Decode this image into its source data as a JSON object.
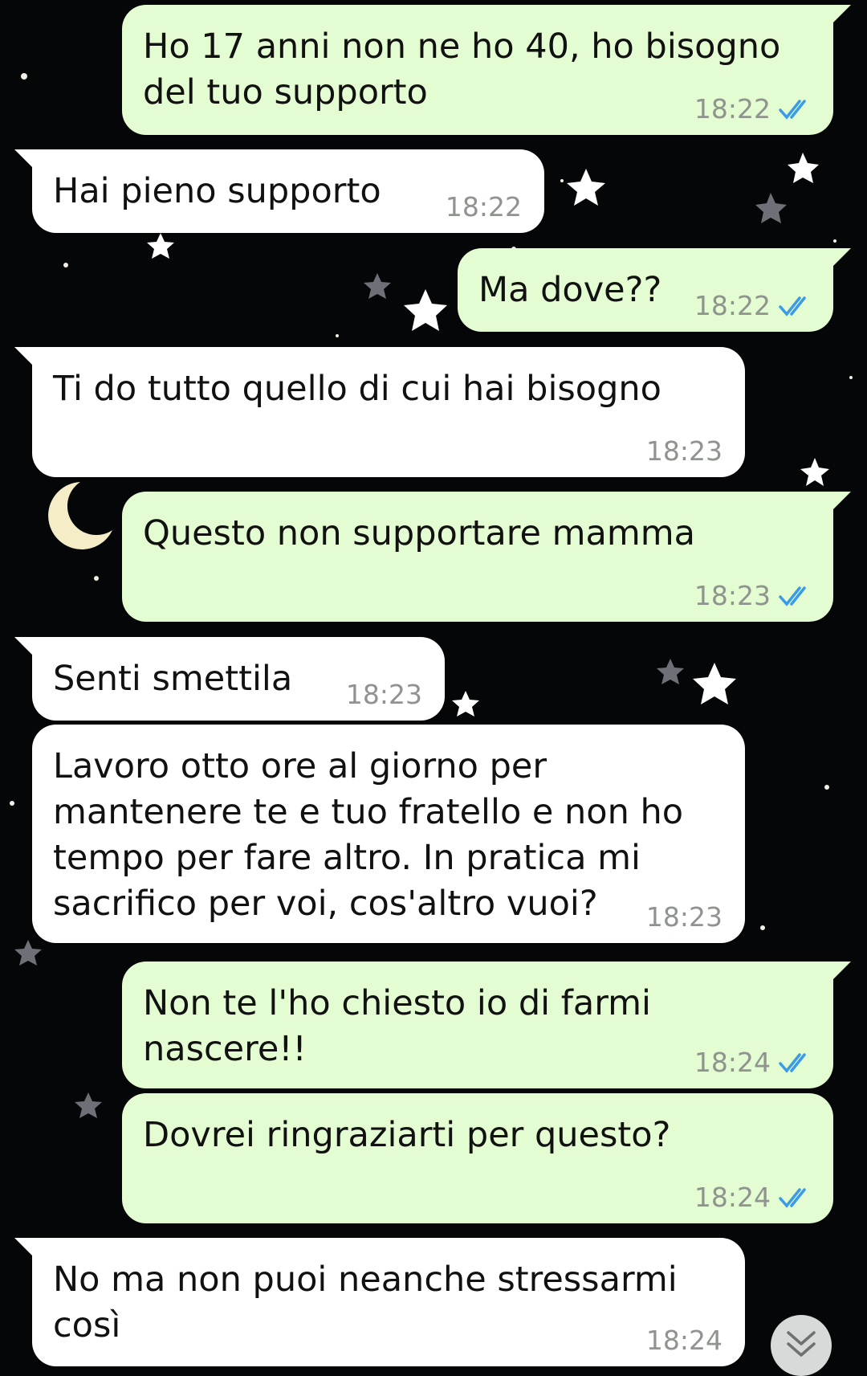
{
  "chat": {
    "messages": [
      {
        "dir": "out",
        "text": "Ho 17 anni non ne ho 40, ho bisogno\ndel tuo supporto",
        "time": "18:22",
        "read": true
      },
      {
        "dir": "in",
        "text": "Hai pieno supporto",
        "time": "18:22"
      },
      {
        "dir": "out",
        "text": "Ma dove??",
        "time": "18:22",
        "read": true
      },
      {
        "dir": "in",
        "text": "Ti do tutto quello di cui hai bisogno",
        "time": "18:23"
      },
      {
        "dir": "out",
        "text": "Questo non supportare mamma",
        "time": "18:23",
        "read": true
      },
      {
        "dir": "in",
        "text": "Senti smettila",
        "time": "18:23"
      },
      {
        "dir": "in",
        "text": "Lavoro otto ore al giorno per\nmantenere te e tuo fratello e non ho\ntempo per fare altro. In pratica mi\nsacrifico per voi, cos'altro vuoi?",
        "time": "18:23"
      },
      {
        "dir": "out",
        "text": "Non te l'ho chiesto io di farmi\nnascere!!",
        "time": "18:24",
        "read": true
      },
      {
        "dir": "out",
        "text": "Dovrei ringraziarti per questo?",
        "time": "18:24",
        "read": true
      },
      {
        "dir": "in",
        "text": "No ma non puoi neanche stressarmi\ncosì",
        "time": "18:24"
      }
    ]
  },
  "colors": {
    "outgoing_bubble": "#e3fcd1",
    "incoming_bubble": "#ffffff",
    "read_ticks": "#3a9be8",
    "background": "#050608"
  },
  "icons": {
    "read_receipt": "double-check-icon",
    "scroll_down": "chevron-double-down-icon",
    "wallpaper": "night-sky-stars-moon"
  }
}
